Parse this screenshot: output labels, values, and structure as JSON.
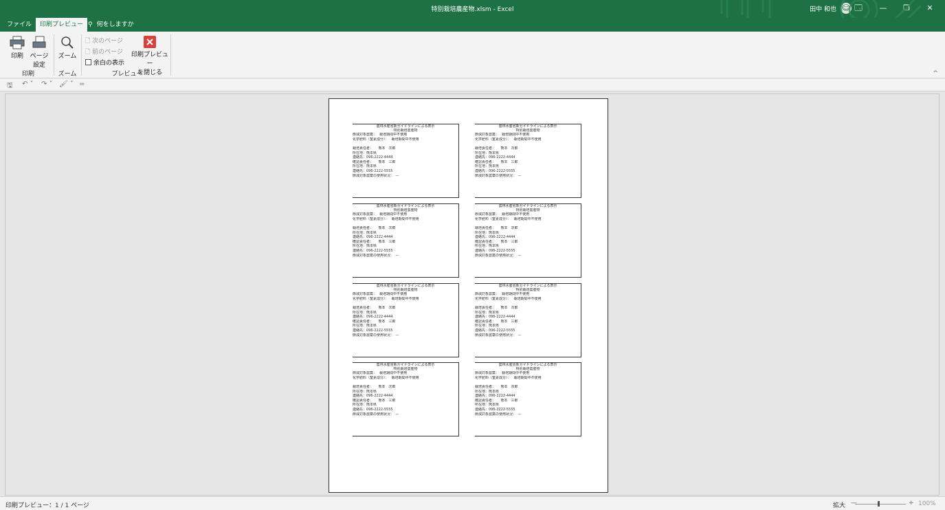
{
  "window": {
    "title": "特別栽培農産物.xlsm  -  Excel",
    "user": "田中 和也",
    "buttons": [
      "🗔",
      "—",
      "❐",
      "✕"
    ]
  },
  "tabs": [
    {
      "label": "ファイル"
    },
    {
      "label": "印刷プレビュー"
    }
  ],
  "tell_me": "何をしますか",
  "ribbon": {
    "print": "印刷",
    "page_setup_1": "ページ",
    "page_setup_2": "設定",
    "zoom": "ズーム",
    "next_page": "次のページ",
    "prev_page": "前のページ",
    "show_margins": "余白の表示",
    "close_preview_1": "印刷プレビュー",
    "close_preview_2": "を閉じる",
    "group_print": "印刷",
    "group_zoom": "ズーム",
    "group_preview": "プレビュー",
    "collapse": "^"
  },
  "qat": [
    "🖫",
    "↶ ˅",
    "↷ ˅",
    "🖌 ˅",
    "="
  ],
  "label_template": {
    "title": "農林水産省新ガイドラインによる表示",
    "subtitle": "特別栽培農産物",
    "rows": [
      "節減対象農薬：　 栽培期間中不使用",
      "化学肥料（窒素成分）：　 栽培期間中不使用",
      "",
      "栽培責任者：　　熊本　次郎",
      "所在地：熊本県",
      "連絡先：096-2222-4444",
      "確認責任者：　　熊本　三郎",
      "所在地：熊本県",
      "連絡先：096-2222-5555",
      "節減対象農薬の使用状況：　—"
    ]
  },
  "status": {
    "text": "印刷プレビュー：1 / 1 ページ",
    "zoom_label": "拡大",
    "zoom_minus": "—",
    "zoom_plus": "+",
    "zoom_pct": "100%"
  }
}
